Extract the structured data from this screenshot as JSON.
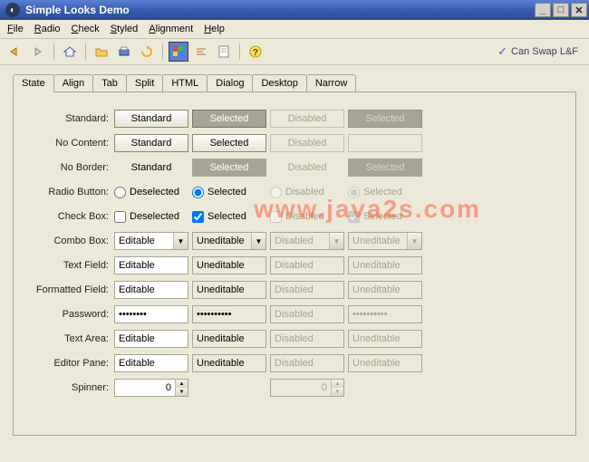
{
  "window": {
    "title": "Simple Looks Demo"
  },
  "menu": {
    "file": "File",
    "radio": "Radio",
    "check": "Check",
    "styled": "Styled",
    "alignment": "Alignment",
    "help": "Help"
  },
  "swap": "Can Swap L&F",
  "tabs": [
    "State",
    "Align",
    "Tab",
    "Split",
    "HTML",
    "Dialog",
    "Desktop",
    "Narrow"
  ],
  "rows": {
    "standard": {
      "label": "Standard:",
      "c1": "Standard",
      "c2": "Selected",
      "c3": "Disabled",
      "c4": "Selected"
    },
    "nocontent": {
      "label": "No Content:",
      "c1": "Standard",
      "c2": "Selected",
      "c3": "Disabled",
      "c4": ""
    },
    "noborder": {
      "label": "No Border:",
      "c1": "Standard",
      "c2": "Selected",
      "c3": "Disabled",
      "c4": "Selected"
    },
    "radio": {
      "label": "Radio Button:",
      "c1": "Deselected",
      "c2": "Selected",
      "c3": "Disabled",
      "c4": "Selected"
    },
    "check": {
      "label": "Check Box:",
      "c1": "Deselected",
      "c2": "Selected",
      "c3": "Disabled",
      "c4": "Selected"
    },
    "combo": {
      "label": "Combo Box:",
      "c1": "Editable",
      "c2": "Uneditable",
      "c3": "Disabled",
      "c4": "Uneditable"
    },
    "textfield": {
      "label": "Text Field:",
      "c1": "Editable",
      "c2": "Uneditable",
      "c3": "Disabled",
      "c4": "Uneditable"
    },
    "formatted": {
      "label": "Formatted Field:",
      "c1": "Editable",
      "c2": "Uneditable",
      "c3": "Disabled",
      "c4": "Uneditable"
    },
    "password": {
      "label": "Password:",
      "c1": "••••••••",
      "c2": "••••••••••",
      "c3": "Disabled",
      "c4": "••••••••••"
    },
    "textarea": {
      "label": "Text Area:",
      "c1": "Editable",
      "c2": "Uneditable",
      "c3": "Disabled",
      "c4": "Uneditable"
    },
    "editorpane": {
      "label": "Editor Pane:",
      "c1": "Editable",
      "c2": "Uneditable",
      "c3": "Disabled",
      "c4": "Uneditable"
    },
    "spinner": {
      "label": "Spinner:",
      "c1": "0",
      "c3": "0"
    }
  },
  "watermark": "www.java2s.com"
}
